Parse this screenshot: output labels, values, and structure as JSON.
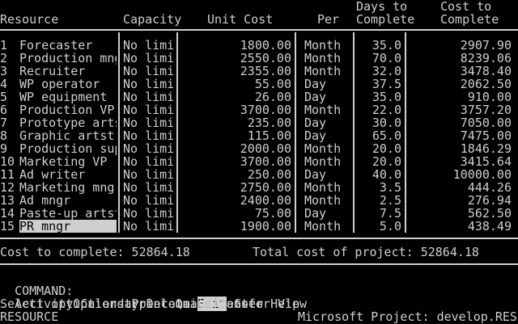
{
  "columns": {
    "resource": "Resource",
    "capacity": "Capacity",
    "unit_cost": "Unit Cost",
    "per": "Per",
    "days_l1": "Days to",
    "days_l2": "Complete",
    "cost_l1": "Cost to",
    "cost_l2": "Complete"
  },
  "rows": [
    {
      "num": "1",
      "name": "Forecaster",
      "capacity": "No limit",
      "unit_cost": "1800.00",
      "per": "Month",
      "days": "35.0",
      "cost": "2907.90"
    },
    {
      "num": "2",
      "name": "Production mngr",
      "capacity": "No limit",
      "unit_cost": "2550.00",
      "per": "Month",
      "days": "70.0",
      "cost": "8239.06"
    },
    {
      "num": "3",
      "name": "Recruiter",
      "capacity": "No limit",
      "unit_cost": "2355.00",
      "per": "Month",
      "days": "32.0",
      "cost": "3478.40"
    },
    {
      "num": "4",
      "name": "WP operator",
      "capacity": "No limit",
      "unit_cost": "55.00",
      "per": "Day",
      "days": "37.5",
      "cost": "2062.50"
    },
    {
      "num": "5",
      "name": "WP equipment",
      "capacity": "No limit",
      "unit_cost": "26.00",
      "per": "Day",
      "days": "35.0",
      "cost": "910.00"
    },
    {
      "num": "6",
      "name": "Production VP",
      "capacity": "No limit",
      "unit_cost": "3700.00",
      "per": "Month",
      "days": "22.0",
      "cost": "3757.20"
    },
    {
      "num": "7",
      "name": "Prototype artst",
      "capacity": "No limit",
      "unit_cost": "235.00",
      "per": "Day",
      "days": "30.0",
      "cost": "7050.00"
    },
    {
      "num": "8",
      "name": "Graphic artst",
      "capacity": "No limit",
      "unit_cost": "115.00",
      "per": "Day",
      "days": "65.0",
      "cost": "7475.00"
    },
    {
      "num": "9",
      "name": "Production sup",
      "capacity": "No limit",
      "unit_cost": "2000.00",
      "per": "Month",
      "days": "20.0",
      "cost": "1846.29"
    },
    {
      "num": "10",
      "name": "Marketing VP",
      "capacity": "No limit",
      "unit_cost": "3700.00",
      "per": "Month",
      "days": "20.0",
      "cost": "3415.64"
    },
    {
      "num": "11",
      "name": "Ad writer",
      "capacity": "No limit",
      "unit_cost": "250.00",
      "per": "Day",
      "days": "40.0",
      "cost": "10000.00"
    },
    {
      "num": "12",
      "name": "Marketing mngr",
      "capacity": "No limit",
      "unit_cost": "2750.00",
      "per": "Month",
      "days": "3.5",
      "cost": "444.26"
    },
    {
      "num": "13",
      "name": "Ad mngr",
      "capacity": "No limit",
      "unit_cost": "2400.00",
      "per": "Month",
      "days": "2.5",
      "cost": "276.94"
    },
    {
      "num": "14",
      "name": "Paste-up artst",
      "capacity": "No limit",
      "unit_cost": "75.00",
      "per": "Day",
      "days": "7.5",
      "cost": "562.50"
    },
    {
      "num": "15",
      "name": "PR mngr",
      "capacity": "No limit",
      "unit_cost": "1900.00",
      "per": "Month",
      "days": "5.0",
      "cost": "438.49"
    }
  ],
  "totals": {
    "cost_to_complete": "Cost to complete: 52864.18",
    "total_cost": "Total cost of project: 52864.18"
  },
  "command": {
    "prefix": "COMMAND:",
    "line1": [
      "Activity",
      "Calendar",
      "Delete",
      "Edit",
      "Goto",
      "Help"
    ],
    "line2": [
      "Options",
      "Print",
      "Quit",
      "Transfer",
      "View"
    ],
    "highlighted": "Edit"
  },
  "prompt": "Select option or type command letter",
  "status": {
    "left": "RESOURCE",
    "right": "Microsoft Project: develop.RES"
  },
  "colors": {
    "fg": "#cfcfcf",
    "bg": "#000000"
  }
}
